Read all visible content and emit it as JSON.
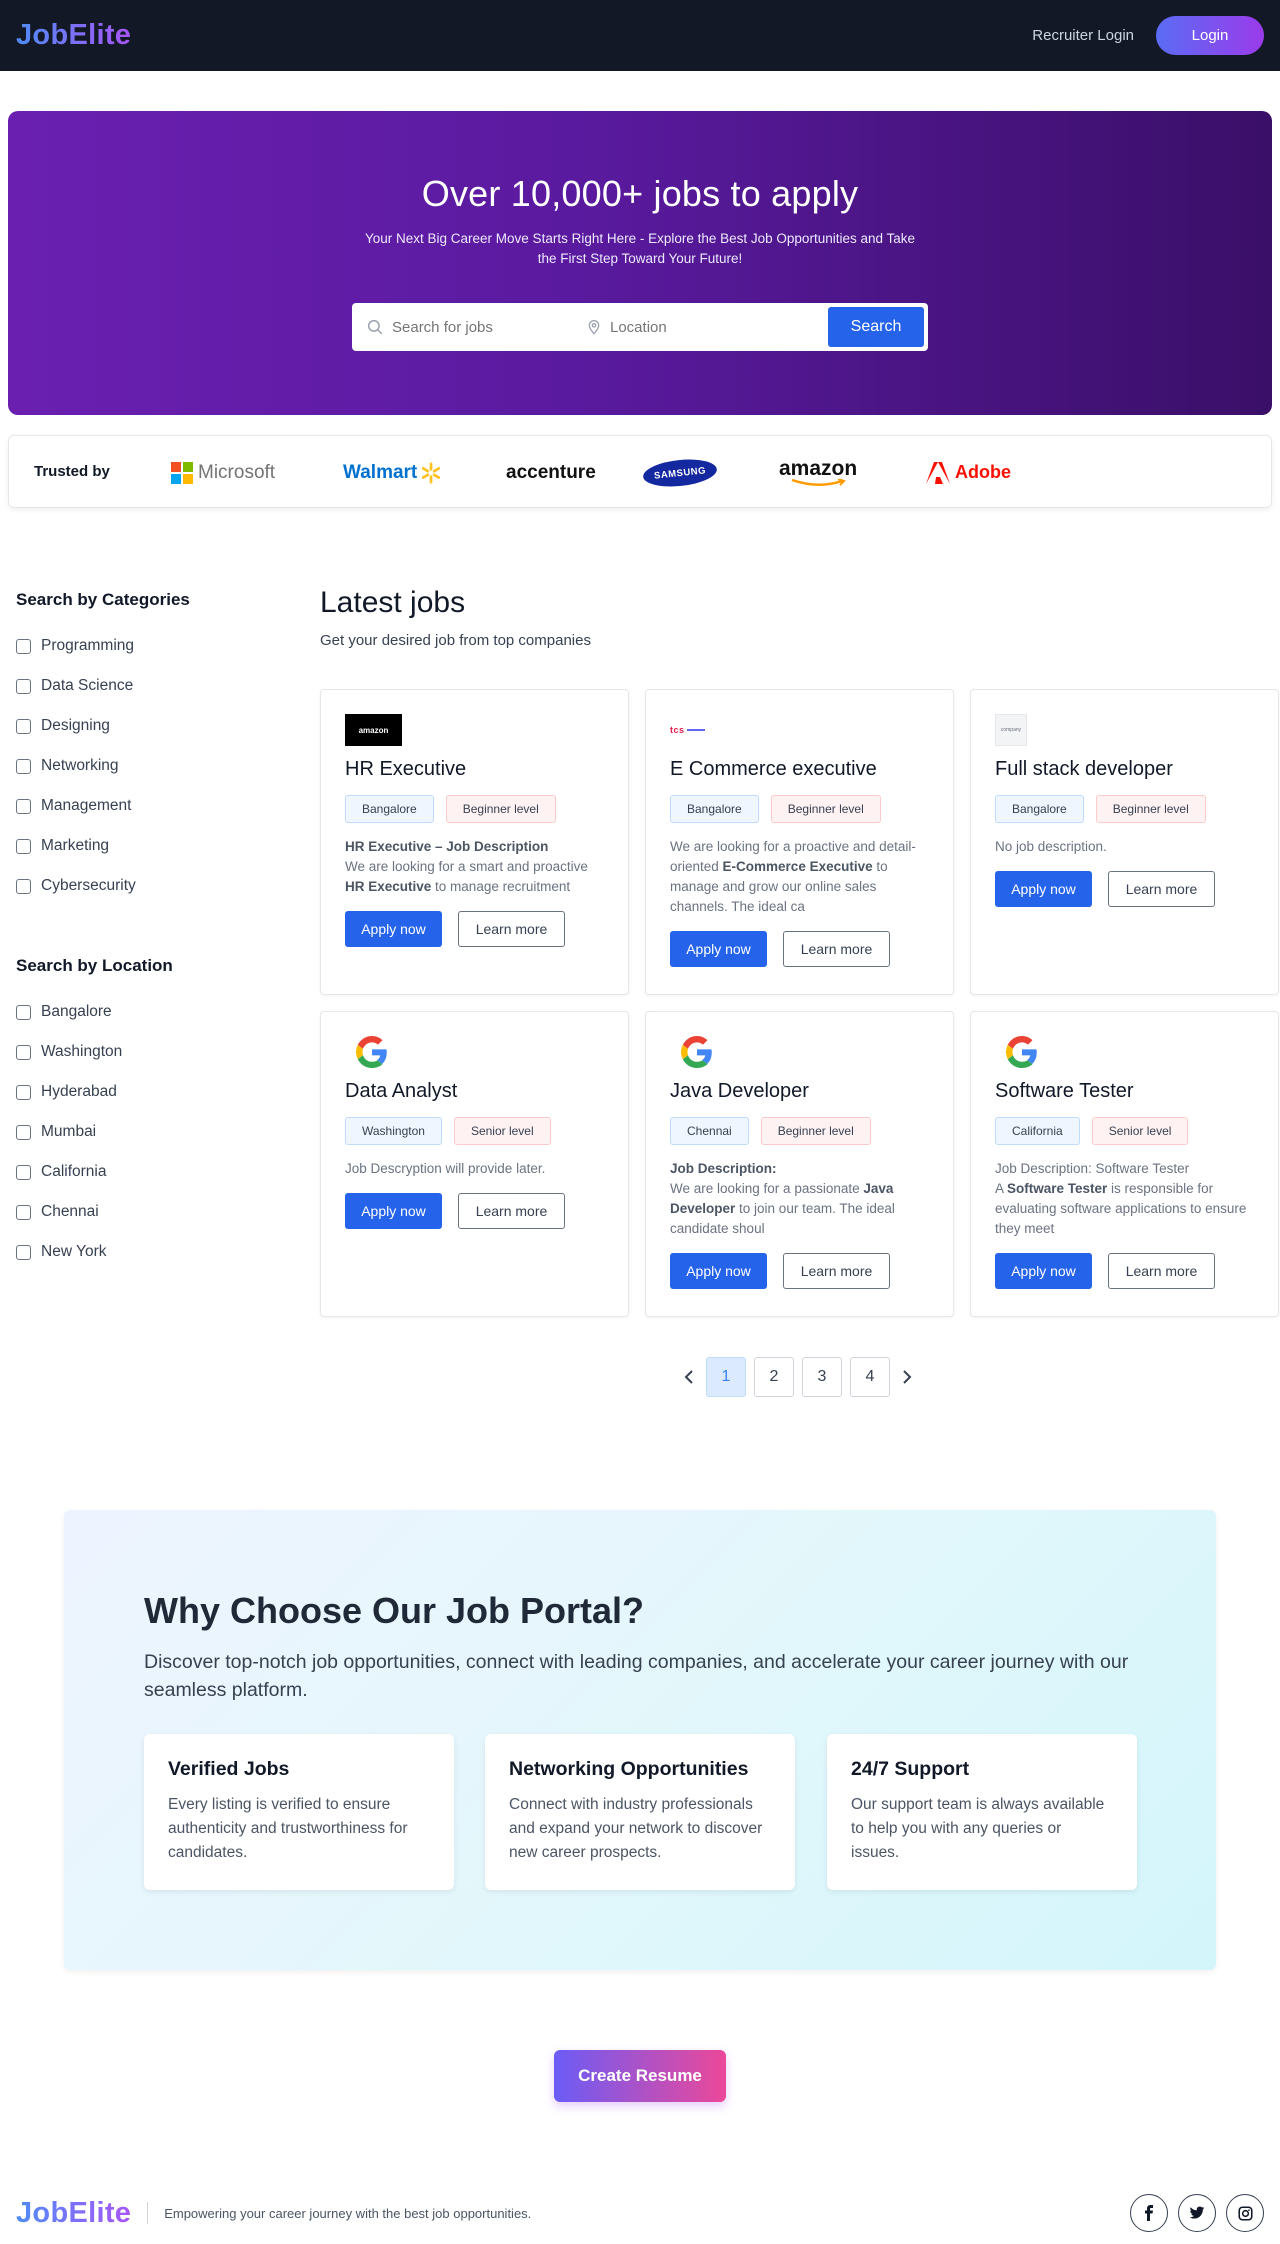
{
  "nav": {
    "logo": "JobElite",
    "recruiter_login": "Recruiter Login",
    "login": "Login"
  },
  "hero": {
    "title": "Over 10,000+ jobs to apply",
    "subtitle": "Your Next Big Career Move Starts Right Here - Explore the Best Job Opportunities and Take the First Step Toward Your Future!",
    "search_placeholder": "Search for jobs",
    "location_placeholder": "Location",
    "search_button": "Search"
  },
  "trusted": {
    "label": "Trusted by",
    "brands": [
      "Microsoft",
      "Walmart",
      "accenture",
      "SAMSUNG",
      "amazon",
      "Adobe"
    ]
  },
  "sidebar": {
    "categories_heading": "Search by Categories",
    "categories": [
      "Programming",
      "Data Science",
      "Designing",
      "Networking",
      "Management",
      "Marketing",
      "Cybersecurity"
    ],
    "location_heading": "Search by Location",
    "locations": [
      "Bangalore",
      "Washington",
      "Hyderabad",
      "Mumbai",
      "California",
      "Chennai",
      "New York"
    ]
  },
  "jobs": {
    "heading": "Latest jobs",
    "subheading": "Get your desired job from top companies",
    "apply_label": "Apply now",
    "learn_label": "Learn more",
    "items": [
      {
        "title": "HR Executive",
        "location": "Bangalore",
        "level": "Beginner level",
        "company_logo": "amazon",
        "desc_heading": "HR Executive – Job Description",
        "desc_pre": "We are looking for a smart and proactive ",
        "desc_bold": "HR Executive",
        "desc_post": " to manage recruitment"
      },
      {
        "title": "E Commerce executive",
        "location": "Bangalore",
        "level": "Beginner level",
        "company_logo": "tcs",
        "desc_heading": "",
        "desc_pre": "We are looking for a proactive and detail-oriented ",
        "desc_bold": "E-Commerce Executive",
        "desc_post": " to manage and grow our online sales channels. The ideal ca"
      },
      {
        "title": "Full stack developer",
        "location": "Bangalore",
        "level": "Beginner level",
        "company_logo": "company",
        "desc_heading": "",
        "desc_pre": "No job description.",
        "desc_bold": "",
        "desc_post": ""
      },
      {
        "title": "Data Analyst",
        "location": "Washington",
        "level": "Senior level",
        "company_logo": "google",
        "desc_heading": "",
        "desc_pre": "Job Descryption will provide later.",
        "desc_bold": "",
        "desc_post": ""
      },
      {
        "title": "Java Developer",
        "location": "Chennai",
        "level": "Beginner level",
        "company_logo": "google",
        "desc_heading": "Job Description:",
        "desc_pre": "We are looking for a passionate ",
        "desc_bold": "Java Developer",
        "desc_post": " to join our team. The ideal candidate shoul"
      },
      {
        "title": "Software Tester",
        "location": "California",
        "level": "Senior level",
        "company_logo": "google",
        "desc_heading": "",
        "desc_line1": "Job Description: Software Tester",
        "desc_pre": "A ",
        "desc_bold": "Software Tester",
        "desc_post": " is responsible for evaluating software applications to ensure they meet"
      }
    ]
  },
  "pagination": {
    "pages": [
      "1",
      "2",
      "3",
      "4"
    ],
    "active": "1"
  },
  "why": {
    "heading": "Why Choose Our Job Portal?",
    "lead": "Discover top-notch job opportunities, connect with leading companies, and accelerate your career journey with our seamless platform.",
    "features": [
      {
        "title": "Verified Jobs",
        "text": "Every listing is verified to ensure authenticity and trustworthiness for candidates."
      },
      {
        "title": "Networking Opportunities",
        "text": "Connect with industry professionals and expand your network to discover new career prospects."
      },
      {
        "title": "24/7 Support",
        "text": "Our support team is always available to help you with any queries or issues."
      }
    ]
  },
  "cta": {
    "label": "Create Resume"
  },
  "footer": {
    "logo": "JobElite",
    "tagline": "Empowering your career journey with the best job opportunities.",
    "socials": [
      "facebook-icon",
      "twitter-icon",
      "instagram-icon"
    ]
  },
  "colors": {
    "nav_bg": "#121826",
    "hero_start": "#6a1fb0",
    "hero_end": "#3a0f68",
    "primary": "#2563eb",
    "cta_start": "#6b5cf6",
    "cta_end": "#ec4899"
  }
}
